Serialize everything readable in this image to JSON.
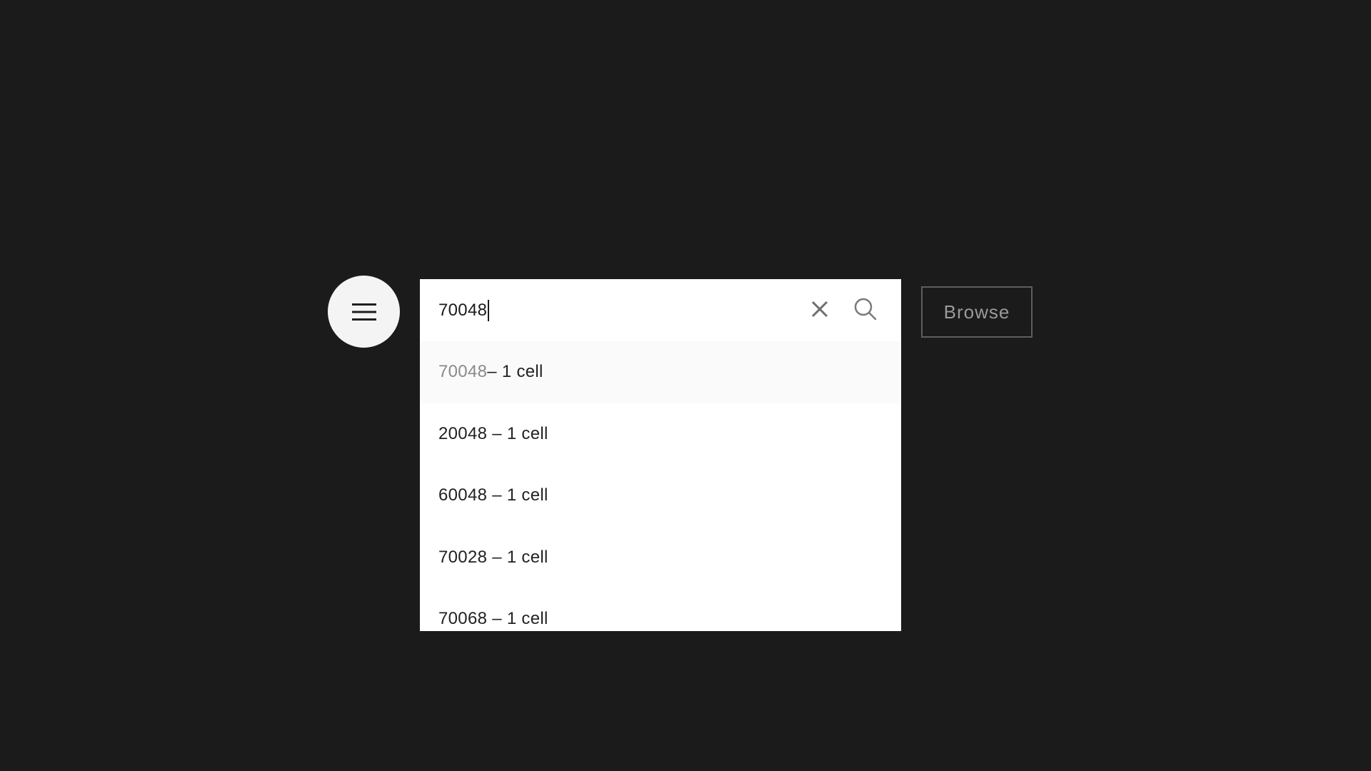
{
  "search": {
    "value": "70048"
  },
  "suggestions": [
    {
      "match": "70048",
      "rest": " – 1 cell"
    },
    {
      "match": "",
      "rest": "20048 – 1 cell"
    },
    {
      "match": "",
      "rest": "60048 – 1 cell"
    },
    {
      "match": "",
      "rest": "70028 – 1 cell"
    },
    {
      "match": "",
      "rest": "70068 – 1 cell"
    }
  ],
  "browse_label": "Browse",
  "icons": {
    "menu": "hamburger-menu-icon",
    "clear": "close-icon",
    "search": "search-icon"
  },
  "colors": {
    "background": "#1b1b1b",
    "menu_button": "#f4f4f4",
    "surface": "#ffffff",
    "active_row": "#fafafa",
    "match_text": "#8a8a8a",
    "browse_border": "#5e5e5e",
    "browse_text": "#9a9a9a"
  }
}
